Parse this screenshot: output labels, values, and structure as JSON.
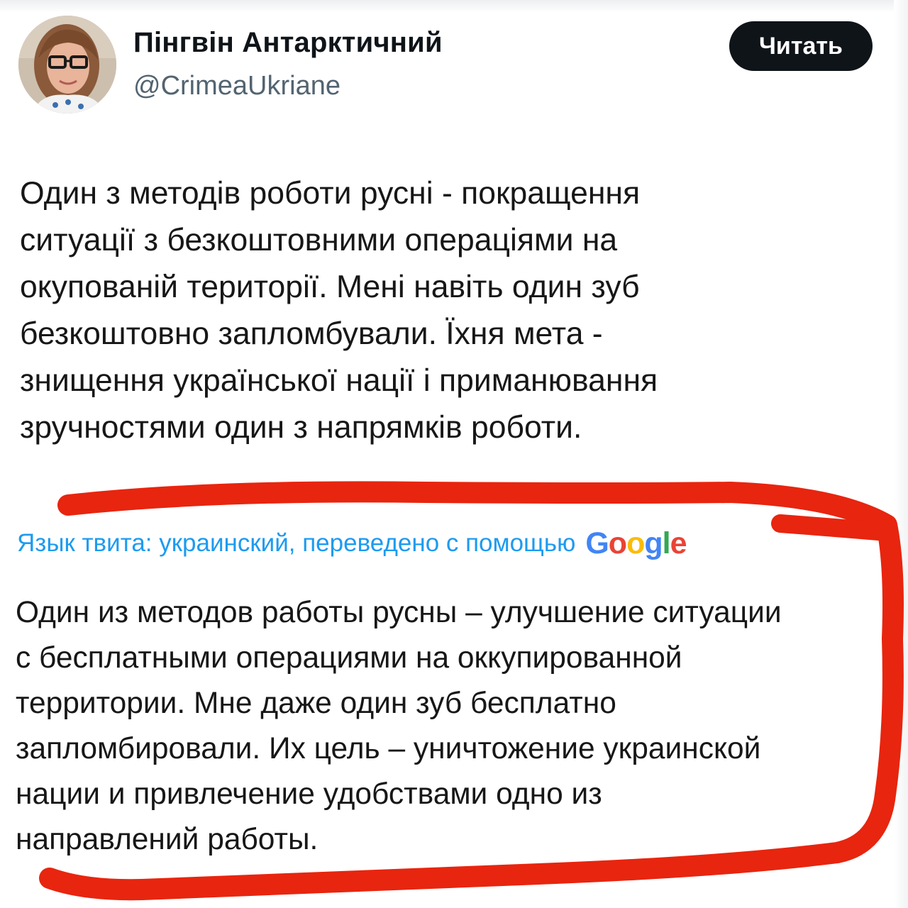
{
  "tweet": {
    "author": {
      "display_name": "Пінгвін Антарктичний",
      "handle": "@CrimeaUkriane",
      "avatar_icon": "user-avatar-photo"
    },
    "follow_button_label": "Читать",
    "text": "Один з методів роботи русні - покращення\nситуації з безкоштовними операціями на\nокупованій території. Мені навіть один зуб\nбезкоштовно запломбували. Їхня мета -\nзнищення української нації і приманювання\nзручностями один з напрямків роботи.",
    "translation": {
      "notice": "Язык твита: украинский, переведено с помощью",
      "provider_logo": "Google",
      "text": "Один из методов работы русны – улучшение ситуации\nс бесплатными операциями на оккупированной\nтерритории. Мне даже один зуб бесплатно\nзапломбировали. Их цель – уничтожение украинской\nнации и привлечение удобствами одно из\nнаправлений работы."
    }
  },
  "colors": {
    "link": "#1d9bf0",
    "button_bg": "#0f1419",
    "annotation": "#e8250f"
  }
}
